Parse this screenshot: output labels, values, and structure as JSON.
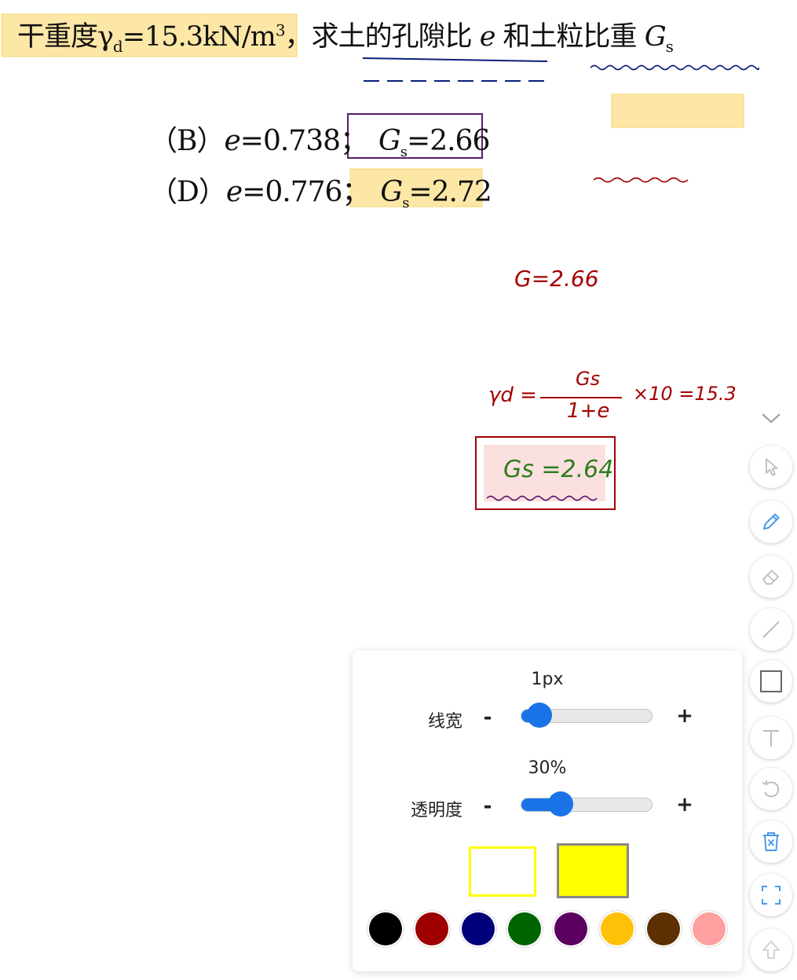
{
  "document": {
    "question_prefix": "干重度γ",
    "question_sub": "d",
    "question_eq": "=15.3kN/m",
    "question_sup": "3",
    "question_sep": "，",
    "question_text_a": "求土的孔隙比 ",
    "question_var_e": "e",
    "question_text_b": " 和土粒比重 ",
    "question_var_g": "G",
    "question_var_g_sub": "s",
    "option_b": {
      "letter": "（B）",
      "e_var": "e",
      "e_value": "=0.738；",
      "gs_var": "G",
      "gs_sub": "s",
      "gs_value": "=2.66"
    },
    "option_d": {
      "letter": "（D）",
      "e_var": "e",
      "e_value": "=0.776；",
      "gs_var": "G",
      "gs_sub": "s",
      "gs_value": "=2.72"
    }
  },
  "annotations": {
    "note_g": "G=2.66",
    "formula_lhs": "γd =",
    "formula_numerator": "Gs",
    "formula_denominator": "1+e",
    "formula_rhs": "×10 =15.3",
    "answer": "Gs =2.64",
    "colors": {
      "highlight": "#fde7a6",
      "purple_box": "#5c1a6b",
      "navy_ink": "#0b1f7a",
      "red_ink": "#a30000",
      "green_ink": "#2e7d1e",
      "answer_fill": "#fbe0e0"
    }
  },
  "toolbar": {
    "collapse": "chevron-down-icon",
    "tools": [
      "select-pointer-icon",
      "pen-icon",
      "eraser-icon",
      "line-icon",
      "rectangle-icon",
      "text-icon",
      "undo-icon",
      "trash-icon",
      "fullscreen-icon",
      "share-icon"
    ],
    "active_tool": "pen-icon"
  },
  "panel": {
    "line_width_value": "1px",
    "line_width_label": "线宽",
    "line_width_level": 0.14,
    "opacity_value": "30%",
    "opacity_label": "透明度",
    "opacity_level": 0.3,
    "minus": "-",
    "plus": "+",
    "stroke_color": "#ffff00",
    "fill_color": "#ffff00",
    "palette": [
      "#000000",
      "#9e0000",
      "#00007a",
      "#006400",
      "#5c0060",
      "#ffc107",
      "#5c3000",
      "#ffa0a0"
    ]
  }
}
